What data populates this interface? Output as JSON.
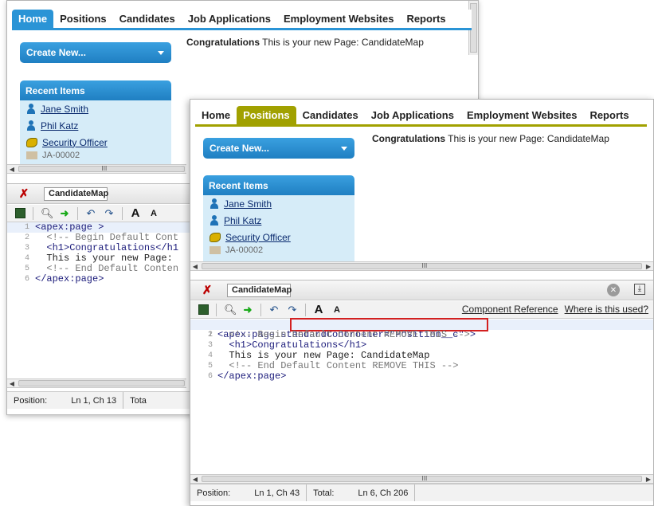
{
  "tabs": [
    "Home",
    "Positions",
    "Candidates",
    "Job Applications",
    "Employment Websites",
    "Reports"
  ],
  "create_new": "Create New...",
  "congrats": {
    "bold": "Congratulations",
    "rest": " This is your new Page: CandidateMap"
  },
  "recent": {
    "title": "Recent Items",
    "items": [
      "Jane Smith",
      "Phil Katz",
      "Security Officer",
      "JA-00002"
    ]
  },
  "dev": {
    "page_name": "CandidateMap",
    "links": [
      "Component Reference",
      "Where is this used?"
    ]
  },
  "code_back": [
    "<apex:page >",
    "  <!-- Begin Default Cont",
    "  <h1>Congratulations</h1",
    "  This is your new Page:",
    "  <!-- End Default Conten",
    "</apex:page>"
  ],
  "code_front": [
    "<apex:page standardController=\"Position__c\" >",
    "  <!-- Begin Default Content REMOVE THIS -->",
    "  <h1>Congratulations</h1>",
    "  This is your new Page: CandidateMap",
    "  <!-- End Default Content REMOVE THIS -->",
    "</apex:page>"
  ],
  "status_back": {
    "position_label": "Position:",
    "position": "Ln 1, Ch 13",
    "total_label": "Tota"
  },
  "status_front": {
    "position_label": "Position:",
    "position": "Ln 1, Ch 43",
    "total_label": "Total:",
    "total": "Ln 6, Ch 206"
  },
  "colors": {
    "active_tab_back": "#2a94d6",
    "active_tab_front": "#a1a100",
    "highlight": "#d32020"
  }
}
